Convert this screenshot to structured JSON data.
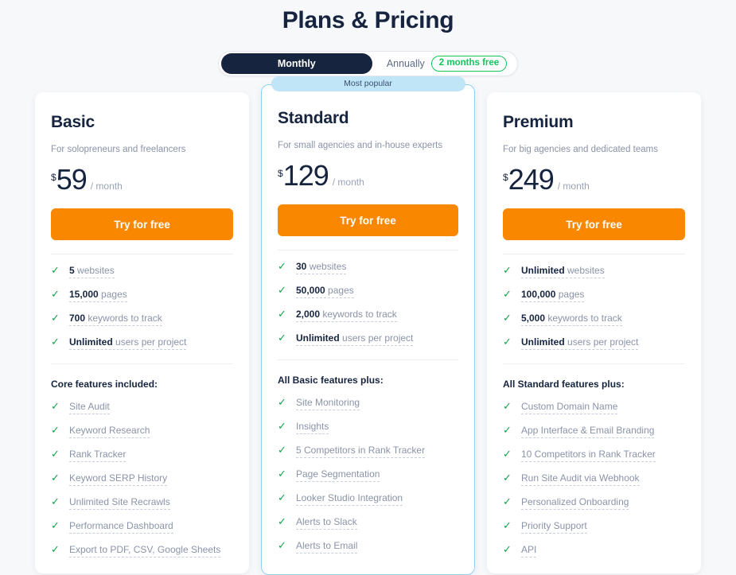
{
  "header": {
    "title": "Plans & Pricing"
  },
  "billing_toggle": {
    "monthly_label": "Monthly",
    "annually_label": "Annually",
    "promo_label": "2 months free",
    "selected": "Monthly"
  },
  "colors": {
    "accent_orange": "#f98700",
    "navy": "#16243f",
    "green": "#11c55a",
    "badge_blue": "#bfe5f7",
    "popular_border": "#8fd3f4",
    "page_bg": "#f7f8fa"
  },
  "plans": [
    {
      "name": "Basic",
      "description": "For solopreneurs and freelancers",
      "currency": "$",
      "price": "59",
      "period": "/ month",
      "cta_label": "Try for free",
      "badge": null,
      "quotas": [
        {
          "value": "5",
          "label": "websites"
        },
        {
          "value": "15,000",
          "label": "pages"
        },
        {
          "value": "700",
          "label": "keywords to track"
        },
        {
          "value": "Unlimited",
          "label": "users per project"
        }
      ],
      "features_heading": "Core features included:",
      "features": [
        "Site Audit",
        "Keyword Research",
        "Rank Tracker",
        "Keyword SERP History",
        "Unlimited Site Recrawls",
        "Performance Dashboard",
        "Export to PDF, CSV, Google Sheets"
      ]
    },
    {
      "name": "Standard",
      "description": "For small agencies and in-house experts",
      "currency": "$",
      "price": "129",
      "period": "/ month",
      "cta_label": "Try for free",
      "badge": "Most popular",
      "quotas": [
        {
          "value": "30",
          "label": "websites"
        },
        {
          "value": "50,000",
          "label": "pages"
        },
        {
          "value": "2,000",
          "label": "keywords to track"
        },
        {
          "value": "Unlimited",
          "label": "users per project"
        }
      ],
      "features_heading": "All Basic features plus:",
      "features": [
        "Site Monitoring",
        "Insights",
        "5 Competitors in Rank Tracker",
        "Page Segmentation",
        "Looker Studio Integration",
        "Alerts to Slack",
        "Alerts to Email"
      ]
    },
    {
      "name": "Premium",
      "description": "For big agencies and dedicated teams",
      "currency": "$",
      "price": "249",
      "period": "/ month",
      "cta_label": "Try for free",
      "badge": null,
      "quotas": [
        {
          "value": "Unlimited",
          "label": "websites"
        },
        {
          "value": "100,000",
          "label": "pages"
        },
        {
          "value": "5,000",
          "label": "keywords to track"
        },
        {
          "value": "Unlimited",
          "label": "users per project"
        }
      ],
      "features_heading": "All Standard features plus:",
      "features": [
        "Custom Domain Name",
        "App Interface & Email Branding",
        "10 Competitors in Rank Tracker",
        "Run Site Audit via Webhook",
        "Personalized Onboarding",
        "Priority Support",
        "API"
      ]
    }
  ],
  "icons": {
    "check": "check-icon"
  }
}
